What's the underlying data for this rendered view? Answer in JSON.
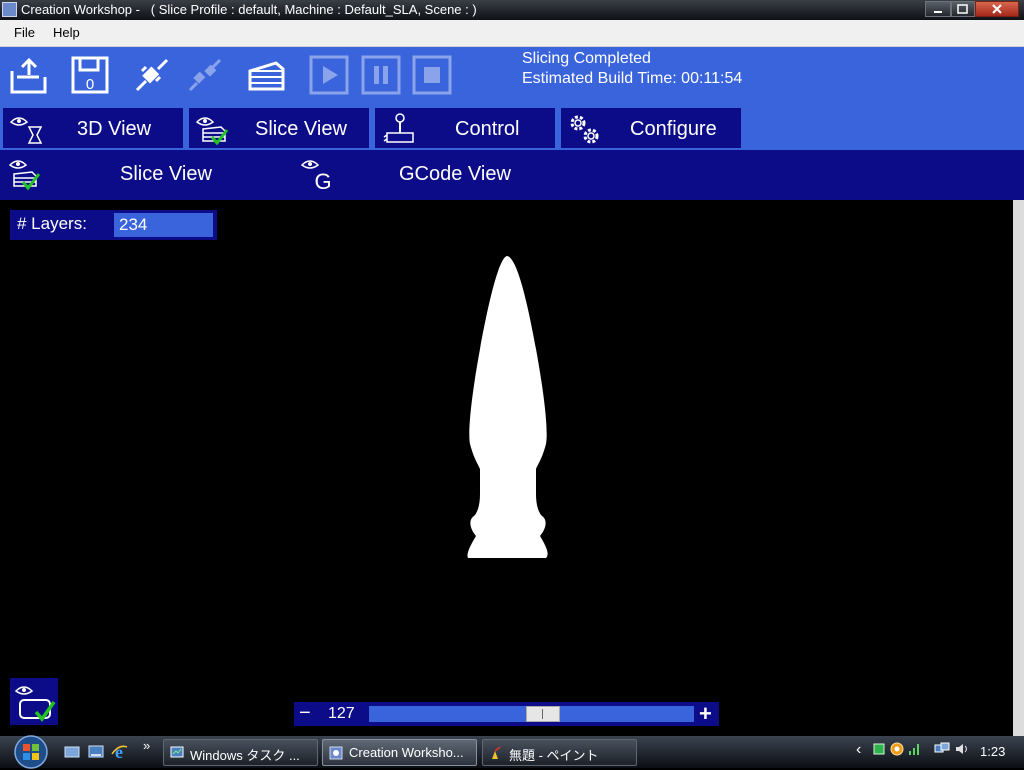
{
  "window": {
    "title": "Creation Workshop -   ( Slice Profile : default, Machine : Default_SLA, Scene : )",
    "minimize_icon": "minimize-icon",
    "maximize_icon": "maximize-icon",
    "close_icon": "close-icon"
  },
  "menu": {
    "items": [
      "File",
      "Help"
    ]
  },
  "toolbar": {
    "icons": [
      "open-file-icon",
      "save-icon",
      "connect-icon",
      "disconnect-icon",
      "slice-icon",
      "play-icon",
      "pause-icon",
      "stop-icon"
    ],
    "status_line1": "Slicing Completed",
    "status_line2": "Estimated Build Time: 00:11:54"
  },
  "tabs": [
    {
      "label": "3D View"
    },
    {
      "label": "Slice View"
    },
    {
      "label": "Control"
    },
    {
      "label": "Configure"
    }
  ],
  "subtabs": [
    {
      "label": "Slice View"
    },
    {
      "label": "GCode View"
    }
  ],
  "viewport": {
    "layers_label": "# Layers:",
    "layers_value": "234",
    "slider_minus": "−",
    "slider_plus": "+",
    "current_layer": "127",
    "slider_fraction": 0.54
  },
  "taskbar": {
    "quicklaunch_more": "»",
    "tasks": [
      {
        "label": "Windows タスク ..."
      },
      {
        "label": "Creation Worksho..."
      },
      {
        "label": "無題 - ペイント"
      }
    ],
    "tray_chevron": "‹",
    "clock": "1:23"
  },
  "colors": {
    "toolbar_blue": "#3a64dc",
    "navy": "#0c0c88",
    "slice_white": "#ffffff"
  }
}
